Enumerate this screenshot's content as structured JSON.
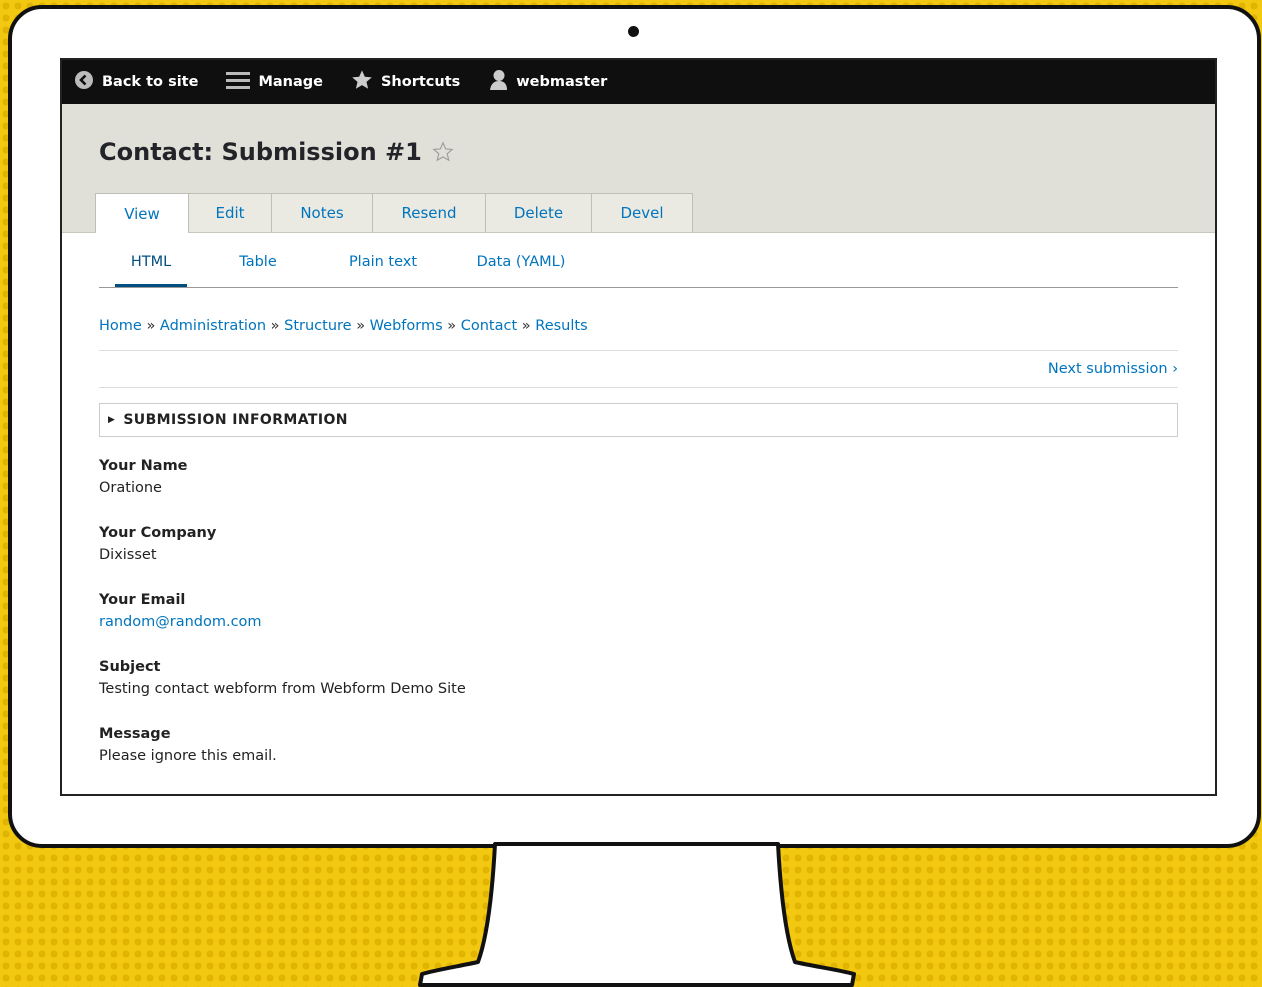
{
  "toolbar": {
    "back": "Back to site",
    "manage": "Manage",
    "shortcuts": "Shortcuts",
    "user": "webmaster"
  },
  "page": {
    "title": "Contact: Submission #1"
  },
  "tabs": [
    "View",
    "Edit",
    "Notes",
    "Resend",
    "Delete",
    "Devel"
  ],
  "subtabs": [
    "HTML",
    "Table",
    "Plain text",
    "Data (YAML)"
  ],
  "breadcrumb": [
    "Home",
    "Administration",
    "Structure",
    "Webforms",
    "Contact",
    "Results"
  ],
  "breadcrumb_separator": "»",
  "pager": {
    "next": "Next submission ›"
  },
  "details": {
    "label": "SUBMISSION INFORMATION"
  },
  "fields": [
    {
      "label": "Your Name",
      "value": "Oratione"
    },
    {
      "label": "Your Company",
      "value": "Dixisset"
    },
    {
      "label": "Your Email",
      "value": "random@random.com"
    },
    {
      "label": "Subject",
      "value": "Testing contact webform from Webform Demo Site"
    },
    {
      "label": "Message",
      "value": "Please ignore this email."
    }
  ],
  "colors": {
    "link": "#0074bd",
    "toolbar": "#0f0f0f",
    "header": "#e0e0d8",
    "background": "#f2c811"
  }
}
